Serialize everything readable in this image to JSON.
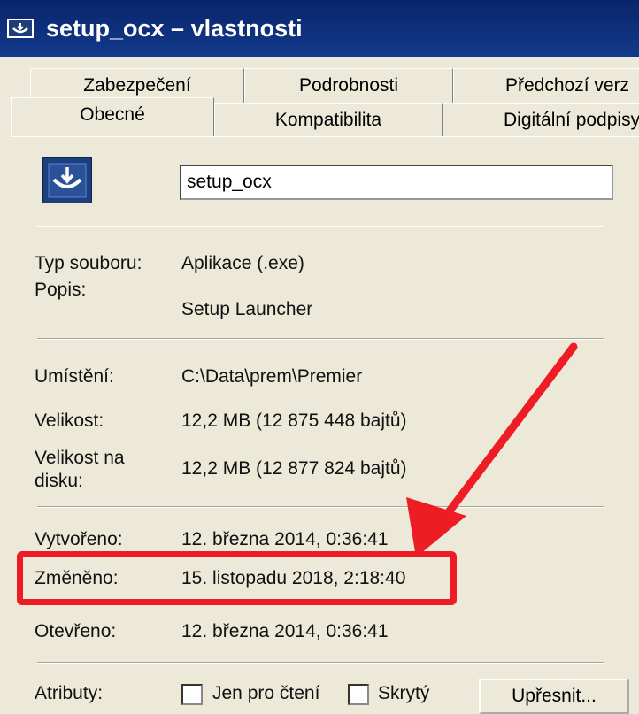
{
  "window": {
    "title": "setup_ocx – vlastnosti"
  },
  "tabs": {
    "row_back": [
      "Zabezpečení",
      "Podrobnosti",
      "Předchozí verz"
    ],
    "row_front": [
      "Obecné",
      "Kompatibilita",
      "Digitální podpisy"
    ],
    "active": "Obecné"
  },
  "general": {
    "file_name": "setup_ocx",
    "type_label": "Typ souboru:",
    "type_value": "Aplikace (.exe)",
    "description_label": "Popis:",
    "description_value": "Setup Launcher",
    "location_label": "Umístění:",
    "location_value": "C:\\Data\\prem\\Premier",
    "size_label": "Velikost:",
    "size_value": "12,2 MB (12 875 448 bajtů)",
    "size_on_disk_label_1": "Velikost na",
    "size_on_disk_label_2": "disku:",
    "size_on_disk_value": "12,2 MB (12 877 824 bajtů)",
    "created_label": "Vytvořeno:",
    "created_value": "12. března 2014, 0:36:41",
    "modified_label": "Změněno:",
    "modified_value": "15. listopadu 2018, 2:18:40",
    "accessed_label": "Otevřeno:",
    "accessed_value": "12. března 2014, 0:36:41",
    "attributes_label": "Atributy:",
    "readonly_label": "Jen pro čtení",
    "hidden_label": "Skrytý",
    "advanced_button": "Upřesnit..."
  },
  "annotation": {
    "color": "#ee1c25"
  }
}
